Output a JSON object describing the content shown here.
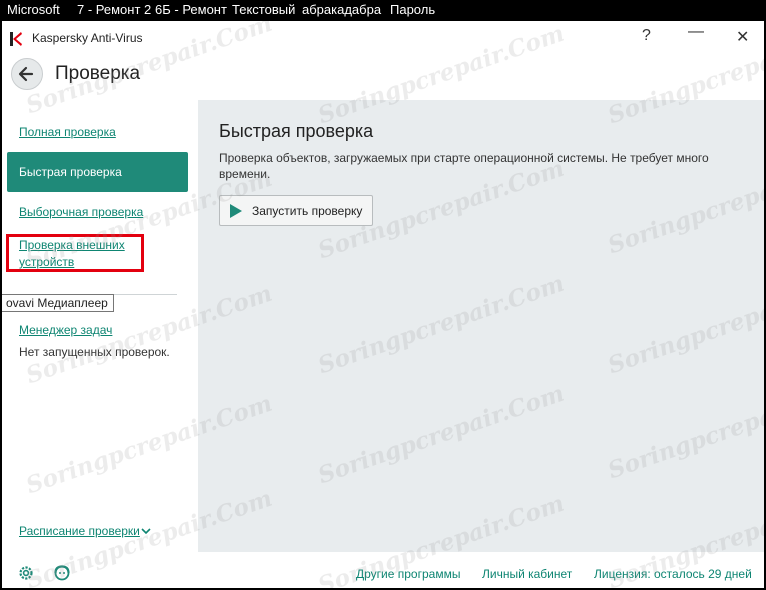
{
  "taskbar": [
    "Microsoft",
    "7 - Ремонт 2",
    "6Б - Ремонт",
    "Текстовый",
    "абракадабра",
    "Пароль"
  ],
  "window": {
    "app_title": "Kaspersky Anti-Virus",
    "help": "?",
    "minimize": "—",
    "close": "✕"
  },
  "header": {
    "title": "Проверка"
  },
  "sidebar": {
    "full_scan": "Полная проверка",
    "quick_scan": "Быстрая проверка",
    "custom_scan": "Выборочная проверка",
    "external_scan_line1": "Проверка внешних",
    "external_scan_line2": "устройств",
    "tooltip": "ovavi Медиаплеер",
    "task_manager": "Менеджер задач",
    "no_scans": "Нет запущенных проверок.",
    "schedule": "Расписание проверки"
  },
  "main": {
    "title": "Быстрая проверка",
    "description": "Проверка объектов, загружаемых при старте операционной системы. Не требует много времени.",
    "run_button": "Запустить проверку"
  },
  "footer": {
    "other_programs": "Другие программы",
    "account": "Личный кабинет",
    "license": "Лицензия: осталось 29 дней"
  },
  "watermark": "Soringpcrepair.Com",
  "colors": {
    "accent": "#1f8a79",
    "highlight": "#e3000f",
    "main_bg": "#e8ecee"
  }
}
